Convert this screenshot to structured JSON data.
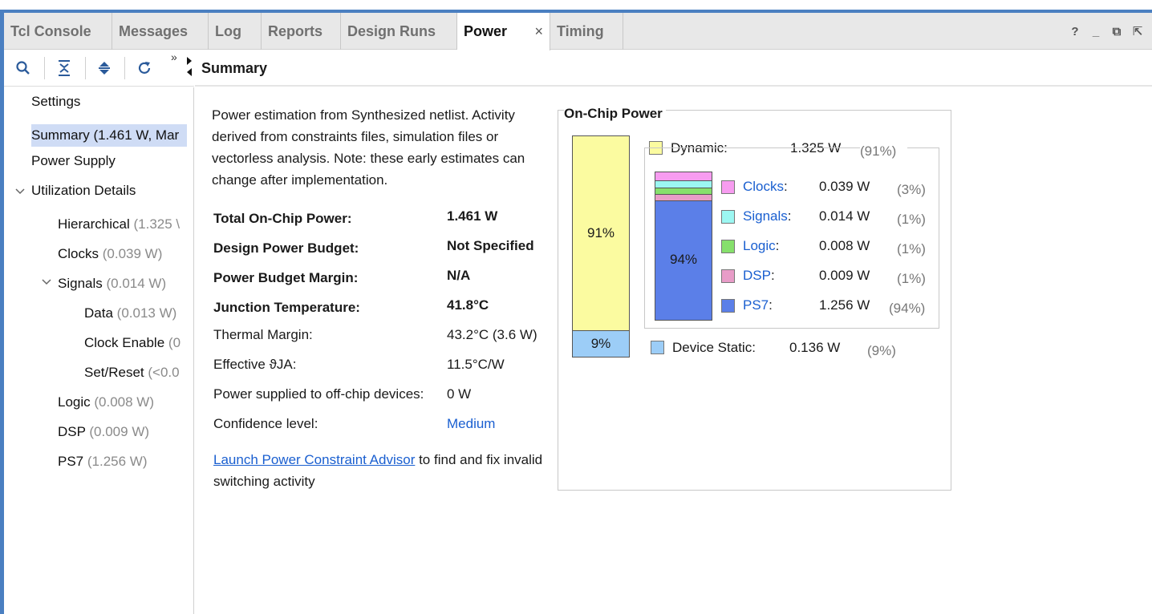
{
  "tabs": [
    {
      "label": "Tcl Console"
    },
    {
      "label": "Messages"
    },
    {
      "label": "Log"
    },
    {
      "label": "Reports"
    },
    {
      "label": "Design Runs"
    },
    {
      "label": "Power",
      "active": true,
      "close": "×"
    },
    {
      "label": "Timing"
    }
  ],
  "window_controls": {
    "help": "?",
    "minimize": "_",
    "restore": "⧉",
    "float": "⇱"
  },
  "toolbar": {
    "overflow": "»",
    "icons": [
      "search-icon",
      "collapse-all-icon",
      "expand-all-icon",
      "refresh-icon"
    ]
  },
  "tree": {
    "settings": "Settings",
    "summary": "Summary (1.461 W, Mar",
    "power_supply": "Power Supply",
    "utilization": "Utilization Details",
    "hierarchical": {
      "label": "Hierarchical",
      "value": "(1.325 \\"
    },
    "clocks": {
      "label": "Clocks",
      "value": "(0.039 W)"
    },
    "signals": {
      "label": "Signals",
      "value": "(0.014 W)"
    },
    "data": {
      "label": "Data",
      "value": "(0.013 W)"
    },
    "clock_enable": {
      "label": "Clock Enable",
      "value": "(0"
    },
    "set_reset": {
      "label": "Set/Reset",
      "value": "(<0.0"
    },
    "logic": {
      "label": "Logic",
      "value": "(0.008 W)"
    },
    "dsp": {
      "label": "DSP",
      "value": "(0.009 W)"
    },
    "ps7": {
      "label": "PS7",
      "value": "(1.256 W)"
    }
  },
  "summary": {
    "header": "Summary",
    "description": "Power estimation from Synthesized netlist. Activity derived from constraints files, simulation files or vectorless analysis. Note: these early estimates can change after implementation.",
    "rows": [
      {
        "label": "Total On-Chip Power:",
        "value": "1.461 W"
      },
      {
        "label": "Design Power Budget:",
        "value": "Not Specified"
      },
      {
        "label": "Power Budget Margin:",
        "value": "N/A"
      },
      {
        "label": "Junction Temperature:",
        "value": "41.8°C"
      },
      {
        "label": "Thermal Margin:",
        "value": "43.2°C (3.6 W)"
      },
      {
        "label": "Effective ϑJA:",
        "value": "11.5°C/W"
      },
      {
        "label": "Power supplied to off-chip devices:",
        "value": "0 W"
      },
      {
        "label": "Confidence level:",
        "value": "Medium"
      }
    ],
    "advisor_link": "Launch Power Constraint Advisor",
    "advisor_text": " to find and fix invalid switching activity"
  },
  "on_chip": {
    "title": "On-Chip Power",
    "dynamic": {
      "label": "Dynamic:",
      "value": "1.325 W",
      "pct": "(91%)",
      "bar_label": "91%",
      "color": "#fbfba0"
    },
    "static": {
      "label": "Device Static:",
      "value": "0.136 W",
      "pct": "(9%)",
      "bar_label": "9%",
      "color": "#9ccdf7"
    },
    "sub_bar_label": "94%",
    "items": [
      {
        "name": "Clocks",
        "value": "0.039 W",
        "pct": "(3%)",
        "color": "#f79cf0"
      },
      {
        "name": "Signals",
        "value": "0.014 W",
        "pct": "(1%)",
        "color": "#9cf7f2"
      },
      {
        "name": "Logic",
        "value": "0.008 W",
        "pct": "(1%)",
        "color": "#86e06c"
      },
      {
        "name": "DSP",
        "value": "0.009 W",
        "pct": "(1%)",
        "color": "#e89cc8"
      },
      {
        "name": "PS7",
        "value": "1.256 W",
        "pct": "(94%)",
        "color": "#5b7fe8"
      }
    ],
    "colon": ":"
  }
}
